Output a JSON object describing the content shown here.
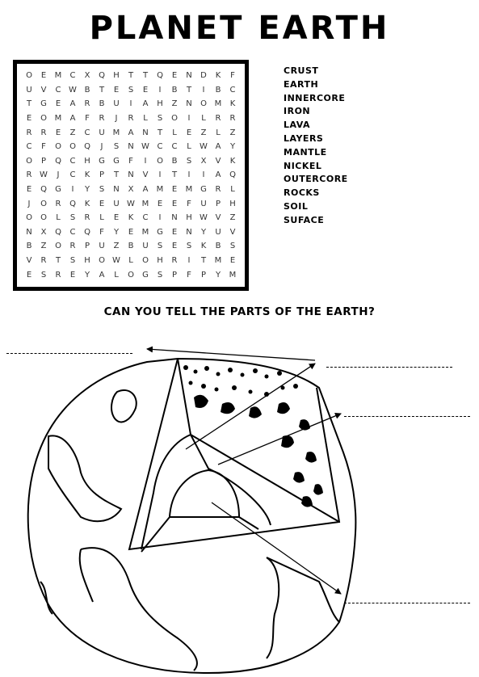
{
  "title": "PLANET EARTH",
  "word_search": {
    "rows": [
      [
        "O",
        "E",
        "M",
        "C",
        "X",
        "Q",
        "H",
        "T",
        "T",
        "Q",
        "E",
        "N",
        "D",
        "K",
        "F"
      ],
      [
        "U",
        "V",
        "C",
        "W",
        "B",
        "T",
        "E",
        "S",
        "E",
        "I",
        "B",
        "T",
        "I",
        "B",
        "C"
      ],
      [
        "T",
        "G",
        "E",
        "A",
        "R",
        "B",
        "U",
        "I",
        "A",
        "H",
        "Z",
        "N",
        "O",
        "M",
        "K"
      ],
      [
        "E",
        "O",
        "M",
        "A",
        "F",
        "R",
        "J",
        "R",
        "L",
        "S",
        "O",
        "I",
        "L",
        "R",
        "R"
      ],
      [
        "R",
        "R",
        "E",
        "Z",
        "C",
        "U",
        "M",
        "A",
        "N",
        "T",
        "L",
        "E",
        "Z",
        "L",
        "Z"
      ],
      [
        "C",
        "F",
        "O",
        "O",
        "Q",
        "J",
        "S",
        "N",
        "W",
        "C",
        "C",
        "L",
        "W",
        "A",
        "Y"
      ],
      [
        "O",
        "P",
        "Q",
        "C",
        "H",
        "G",
        "G",
        "F",
        "I",
        "O",
        "B",
        "S",
        "X",
        "V",
        "K"
      ],
      [
        "R",
        "W",
        "J",
        "C",
        "K",
        "P",
        "T",
        "N",
        "V",
        "I",
        "T",
        "I",
        "I",
        "A",
        "Q"
      ],
      [
        "E",
        "Q",
        "G",
        "I",
        "Y",
        "S",
        "N",
        "X",
        "A",
        "M",
        "E",
        "M",
        "G",
        "R",
        "L"
      ],
      [
        "J",
        "O",
        "R",
        "Q",
        "K",
        "E",
        "U",
        "W",
        "M",
        "E",
        "E",
        "F",
        "U",
        "P",
        "H"
      ],
      [
        "O",
        "O",
        "L",
        "S",
        "R",
        "L",
        "E",
        "K",
        "C",
        "I",
        "N",
        "H",
        "W",
        "V",
        "Z"
      ],
      [
        "N",
        "X",
        "Q",
        "C",
        "Q",
        "F",
        "Y",
        "E",
        "M",
        "G",
        "E",
        "N",
        "Y",
        "U",
        "V"
      ],
      [
        "B",
        "Z",
        "O",
        "R",
        "P",
        "U",
        "Z",
        "B",
        "U",
        "S",
        "E",
        "S",
        "K",
        "B",
        "S"
      ],
      [
        "V",
        "R",
        "T",
        "S",
        "H",
        "O",
        "W",
        "L",
        "O",
        "H",
        "R",
        "I",
        "T",
        "M",
        "E"
      ],
      [
        "E",
        "S",
        "R",
        "E",
        "Y",
        "A",
        "L",
        "O",
        "G",
        "S",
        "P",
        "F",
        "P",
        "Y",
        "M"
      ]
    ]
  },
  "word_list": [
    "CRUST",
    "EARTH",
    "INNERCORE",
    "IRON",
    "LAVA",
    "LAYERS",
    "MANTLE",
    "NICKEL",
    "OUTERCORE",
    "ROCKS",
    "SOIL",
    "SUFACE"
  ],
  "question": "CAN YOU TELL THE PARTS OF THE EARTH?"
}
